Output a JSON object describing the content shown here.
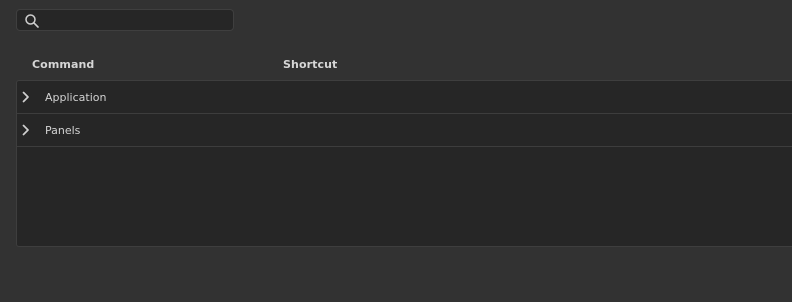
{
  "search": {
    "placeholder": "",
    "value": "",
    "icon": "search-icon"
  },
  "columns": {
    "command": "Command",
    "shortcut": "Shortcut"
  },
  "rows": [
    {
      "label": "Application",
      "icon": "chevron-right-icon",
      "expanded": false
    },
    {
      "label": "Panels",
      "icon": "chevron-right-icon",
      "expanded": false
    }
  ],
  "colors": {
    "background": "#323232",
    "panel": "#262626",
    "border": "#3e3e3e",
    "text": "#d2d2d2"
  }
}
